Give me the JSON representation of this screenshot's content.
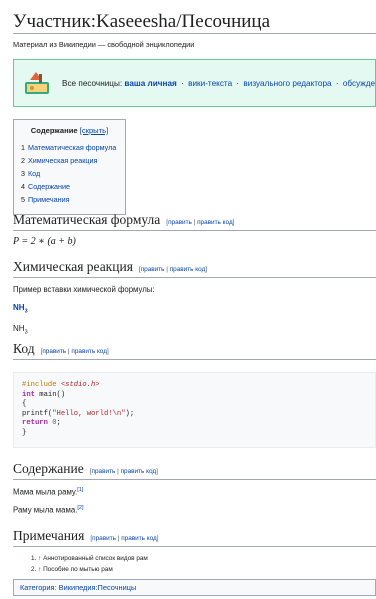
{
  "title": "Участник:Kaseeesha/Песочница",
  "tagline": "Материал из Википедии — свободной энциклопедии",
  "sandboxes": {
    "intro": "Все песочницы:",
    "links": [
      "ваша личная",
      "вики-текста",
      "визуального редактора",
      "обсуждений"
    ]
  },
  "toc": {
    "title": "Содержание",
    "toggle": "[скрыть]",
    "items": [
      {
        "num": "1",
        "label": "Математическая формула"
      },
      {
        "num": "2",
        "label": "Химическая реакция"
      },
      {
        "num": "3",
        "label": "Код"
      },
      {
        "num": "4",
        "label": "Содержание"
      },
      {
        "num": "5",
        "label": "Примечания"
      }
    ]
  },
  "edit": {
    "open": "[",
    "edit": "править",
    "bar": "|",
    "edit_code": "править код",
    "close": "]"
  },
  "sections": {
    "math": {
      "heading": "Математическая формула",
      "formula": "P = 2 ∗ (a + b)"
    },
    "chem": {
      "heading": "Химическая реакция",
      "intro": "Пример вставки химической формулы:",
      "f1": "NH",
      "f1_sub": "3",
      "f2": "NH",
      "f2_sub": "3"
    },
    "code": {
      "heading": "Код"
    },
    "content": {
      "heading": "Содержание",
      "line1": "Мама мыла раму.",
      "ref1": "[1]",
      "line2": "Раму мыла мама.",
      "ref2": "[2]"
    },
    "notes": {
      "heading": "Примечания",
      "refs": [
        "1. ↑ Аннотированный список видов рам",
        "2. ↑ Пособие по мытью рам"
      ]
    }
  },
  "code_lines": {
    "l1a": "#include ",
    "l1b": "<stdio.h>",
    "l2a": "int",
    "l2b": " main()",
    "l3": "{",
    "l4a": "printf(",
    "l4b": "\"Hello, world!\\n\"",
    "l4c": ");",
    "l5a": "return",
    "l5b": " ",
    "l5c": "0",
    "l5d": ";",
    "l6": "}"
  },
  "categories": {
    "label": "Категория:",
    "item": "Википедия:Песочницы"
  },
  "colors": {
    "link": "#0645ad",
    "sandbox_bg": "#e3f9f1",
    "sandbox_border": "#6ac5a1"
  }
}
